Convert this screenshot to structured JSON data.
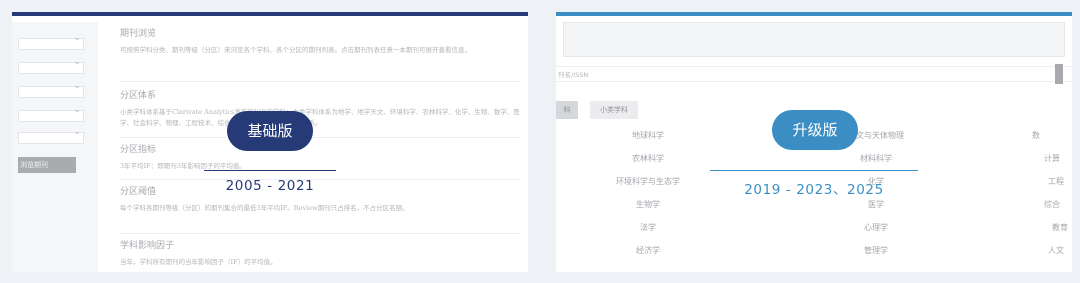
{
  "basic": {
    "badge": "基础版",
    "years": "2005 - 2021",
    "sidebar": {
      "button": "浏览期刊"
    },
    "sections": [
      {
        "title": "期刊浏览",
        "text": "可按照学科分类、期刊等级（分区）来浏览各个学科、各个分区的期刊列表。点击期刊列表任意一本期刊可展开查看信息。"
      },
      {
        "title": "分区体系",
        "text": "小类学科体系基于Clarivate Analytics发布的JCR的学科；大类学科体系为地学、地学天文、环境科学、农林科学、化学、生物、数学、医学、社会科学、物理、工程技术、综合性期刊等学科构成的分类体系。"
      },
      {
        "title": "分区指标",
        "text": "3年平均IF：即期刊3年影响因子的平均值。"
      },
      {
        "title": "分区阈值",
        "text": "每个学科各期刊等级（分区）的期刊集合的最低3年平均IF。Review期刊只占排名，不占分区名额。"
      },
      {
        "title": "学科影响因子",
        "text": "当年，学科所有期刊的当年影响因子（IF）的平均值。"
      }
    ]
  },
  "upgrade": {
    "badge": "升级版",
    "years": "2019 - 2023、2025",
    "search_label": "刊名/ISSN",
    "tabs": [
      "科",
      "小类学科"
    ],
    "subjects": [
      [
        "地球科学",
        "天文与天体物理",
        "数"
      ],
      [
        "农林科学",
        "材料科学",
        "计算"
      ],
      [
        "环境科学与生态学",
        "化学",
        "工程"
      ],
      [
        "生物学",
        "医学",
        "综合"
      ],
      [
        "法学",
        "心理学",
        "教育"
      ],
      [
        "经济学",
        "管理学",
        "人文"
      ]
    ]
  }
}
